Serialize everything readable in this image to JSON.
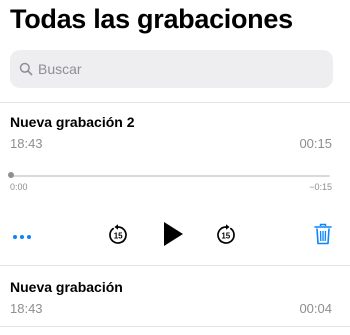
{
  "header": {
    "title": "Todas las grabaciones"
  },
  "search": {
    "placeholder": "Buscar",
    "icon": "search-icon"
  },
  "recordings": [
    {
      "name": "Nueva grabación 2",
      "time": "18:43",
      "duration": "00:15",
      "expanded": true,
      "player": {
        "elapsed": "0:00",
        "remaining": "−0:15",
        "progress": 0
      },
      "controls": {
        "more": "more-icon",
        "skip_back": "15",
        "play": "play-icon",
        "skip_forward": "15",
        "delete": "trash-icon"
      }
    },
    {
      "name": "Nueva grabación",
      "time": "18:43",
      "duration": "00:04",
      "expanded": false
    }
  ],
  "colors": {
    "accent": "#0a84ff",
    "secondary_text": "#8e8e93",
    "search_bg": "#eeeef0",
    "divider": "#e3e3e6"
  }
}
